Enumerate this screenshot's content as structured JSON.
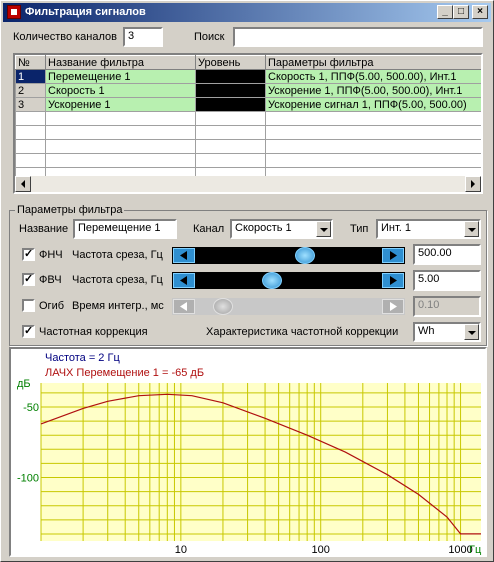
{
  "window": {
    "title": "Фильтрация сигналов",
    "min": "_",
    "max": "□",
    "close": "×"
  },
  "top": {
    "channels_label": "Количество каналов",
    "channels_value": "3",
    "search_label": "Поиск",
    "search_value": ""
  },
  "table": {
    "headers": [
      "№",
      "Название фильтра",
      "Уровень",
      "Параметры фильтра"
    ],
    "rows": [
      {
        "num": "1",
        "name": "Перемещение 1",
        "params": "Скорость 1, ППФ(5.00, 500.00), Инт.1"
      },
      {
        "num": "2",
        "name": "Скорость 1",
        "params": "Ускорение 1, ППФ(5.00, 500.00), Инт.1"
      },
      {
        "num": "3",
        "name": "Ускорение 1",
        "params": "Ускорение сигнал 1, ППФ(5.00, 500.00)"
      }
    ]
  },
  "params": {
    "group_title": "Параметры фильтра",
    "name_label": "Название",
    "name_value": "Перемещение 1",
    "channel_label": "Канал",
    "channel_value": "Скорость 1",
    "type_label": "Тип",
    "type_value": "Инт. 1",
    "lpf_label": "ФНЧ",
    "lpf_cut_label": "Частота среза, Гц",
    "lpf_value": "500.00",
    "lpf_checked": true,
    "lpf_level": 0.6,
    "hpf_label": "ФВЧ",
    "hpf_cut_label": "Частота среза, Гц",
    "hpf_value": "5.00",
    "hpf_checked": true,
    "hpf_level": 0.4,
    "env_label": "Огиб",
    "env_time_label": "Время интегр., мс",
    "env_value": "0.10",
    "env_checked": false,
    "env_level": 0.1,
    "freqcorr_label": "Частотная коррекция",
    "freqcorr_checked": true,
    "freqcorr_char_label": "Характеристика частотной коррекции",
    "freqcorr_value": "Wh"
  },
  "chart_data": {
    "type": "line",
    "legend": [
      "Частота = 2 Гц",
      "ЛАЧХ Перемещение 1 = -65 дБ"
    ],
    "ylabel": "дБ",
    "xlabel": "Гц",
    "x_scale": "log",
    "xlim": [
      1,
      1400
    ],
    "ylim": [
      -145,
      -33
    ],
    "x_ticks": [
      10,
      100,
      1000
    ],
    "y_ticks": [
      -50,
      -100
    ],
    "series": [
      {
        "name": "ЛАЧХ Перемещение 1",
        "color": "#b01010",
        "x": [
          1,
          2,
          3,
          5,
          8,
          12,
          20,
          40,
          80,
          150,
          300,
          500,
          800,
          1000,
          1400
        ],
        "y": [
          -62,
          -51,
          -46,
          -42,
          -41,
          -42,
          -47,
          -58,
          -70,
          -82,
          -98,
          -112,
          -128,
          -140,
          -140
        ]
      }
    ],
    "grid": true,
    "colors": {
      "bg": "#ffffc8",
      "grid": "#c8c800",
      "axis_label": "#008000",
      "tick": "#000000"
    }
  }
}
